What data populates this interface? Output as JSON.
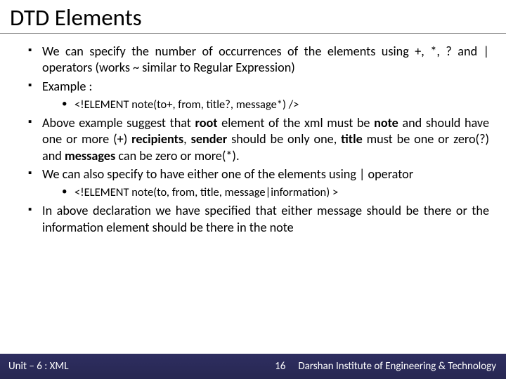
{
  "title": "DTD Elements",
  "bullets": {
    "b1": "We can specify the number of occurrences of the elements using +, *, ? and | operators (works ~ similar to Regular Expression)",
    "b2": "Example :",
    "c2a": "<!ELEMENT note(to+, from, title?, message*) />",
    "b3_pre": "Above example suggest that ",
    "b3_root": "root",
    "b3_mid1": " element of the xml must be ",
    "b3_note": "note",
    "b3_mid2": " and should have one or more (+) ",
    "b3_recip": "recipients",
    "b3_mid3": ", ",
    "b3_sender": "sender",
    "b3_mid4": " should be only one, ",
    "b3_title": "title",
    "b3_mid5": " must be one or zero(?) and ",
    "b3_msg": "messages",
    "b3_end": " can be zero or more(*).",
    "b4": "We can also specify to have either one of the elements using | operator",
    "c4a": "<!ELEMENT note(to, from, title, message|information) >",
    "b5": "In above declaration we have specified that either message should be there or the information element should be there in the note"
  },
  "footer": {
    "left": "Unit – 6 : XML",
    "page": "16",
    "right": "Darshan Institute of Engineering & Technology"
  }
}
